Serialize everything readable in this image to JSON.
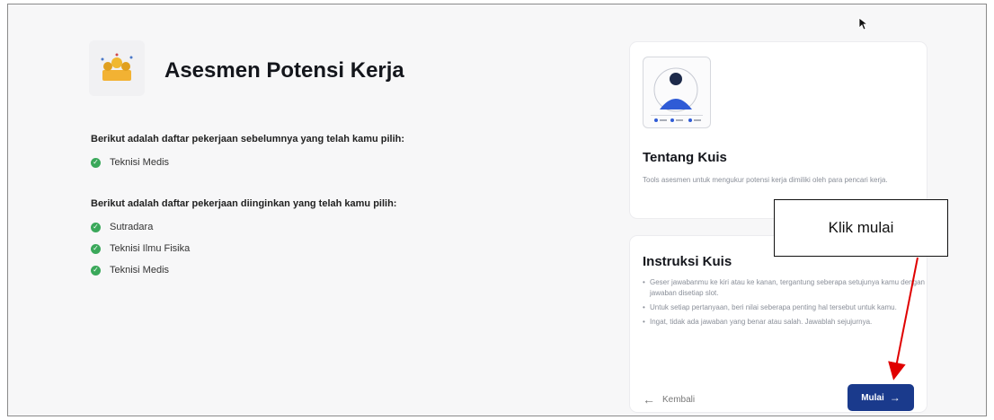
{
  "header": {
    "title": "Asesmen Potensi Kerja"
  },
  "previous_jobs": {
    "heading": "Berikut adalah daftar pekerjaan sebelumnya yang telah kamu pilih:",
    "items": [
      "Teknisi Medis"
    ]
  },
  "desired_jobs": {
    "heading": "Berikut adalah daftar pekerjaan diinginkan yang telah kamu pilih:",
    "items": [
      "Sutradara",
      "Teknisi Ilmu Fisika",
      "Teknisi Medis"
    ]
  },
  "about_card": {
    "title": "Tentang Kuis",
    "description": "Tools asesmen untuk mengukur potensi kerja dimiliki oleh para pencari kerja."
  },
  "instructions_card": {
    "title": "Instruksi Kuis",
    "items": [
      "Geser jawabanmu ke kiri atau ke kanan, tergantung seberapa setujunya kamu dengan jawaban disetiap slot.",
      "Untuk setiap pertanyaan, beri nilai seberapa penting hal tersebut untuk kamu.",
      "Ingat, tidak ada jawaban yang benar atau salah. Jawablah sejujurnya."
    ],
    "back_label": "Kembali",
    "start_label": "Mulai"
  },
  "annotation": {
    "callout_text": "Klik mulai"
  },
  "colors": {
    "accent": "#1a3a8c",
    "check": "#3aa85a",
    "arrow": "#e00000"
  }
}
